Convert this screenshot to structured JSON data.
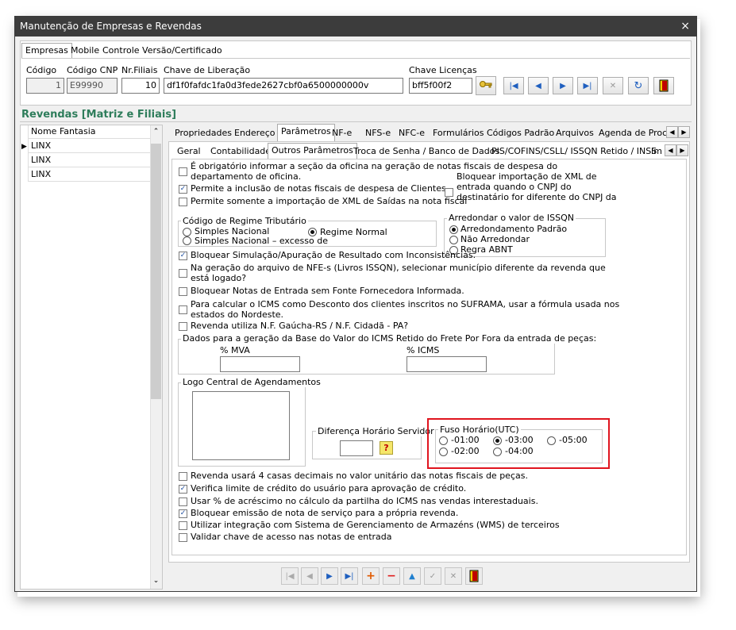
{
  "window": {
    "title": "Manutenção de Empresas e Revendas",
    "close": "×"
  },
  "top_tabs": [
    "Empresas",
    "Mobile",
    "Controle Versão/Certificado"
  ],
  "fields": {
    "codigo_label": "Código",
    "codigo_value": "1",
    "codigo_cnp_label": "Código CNP",
    "codigo_cnp_value": "E99990",
    "nr_filiais_label": "Nr.Filiais",
    "nr_filiais_value": "10",
    "chave_liberacao_label": "Chave de Liberação",
    "chave_liberacao_value": "df1f0fafdc1fa0d3fede2627cbf0a6500000000v",
    "chave_licencas_label": "Chave Licenças",
    "chave_licencas_value": "bff5f00f2"
  },
  "revendas": {
    "title": "Revendas [Matriz e Filiais]",
    "column": "Nome Fantasia",
    "rows": [
      "LINX",
      "LINX",
      "LINX"
    ]
  },
  "main_tabs": [
    "Propriedades",
    "Endereço",
    "Parâmetros",
    "NF-e",
    "NFS-e",
    "NFC-e",
    "Formulários",
    "Códigos Padrão",
    "Arquivos",
    "Agenda de Proces"
  ],
  "sub_tabs": [
    "Geral",
    "Contabilidade",
    "Outros Parâmetros",
    "Troca de Senha / Banco de Dados",
    "PIS/COFINS/CSLL/ ISSQN Retido / INSS",
    "Im"
  ],
  "checks_top": [
    {
      "label": "É obrigatório informar a seção da oficina na geração de notas fiscais de despesa do",
      "label2": "departamento de oficina.",
      "checked": false
    },
    {
      "label": "Permite a inclusão de notas fiscais de despesa de Clientes.",
      "checked": true
    },
    {
      "label": "Permite somente a importação de XML de Saídas na nota fiscal",
      "checked": false
    }
  ],
  "check_xml": {
    "line1": "Bloquear importação de XML de",
    "line2": "entrada quando o CNPJ do",
    "line3": "destinatário for diferente do CNPJ da",
    "checked": false
  },
  "regime": {
    "title": "Código de Regime Tributário",
    "opt1": "Simples Nacional",
    "opt2": "Simples Nacional – excesso de",
    "opt3": "Regime Normal",
    "selected": "Regime Normal"
  },
  "issqn": {
    "title": "Arredondar o valor de ISSQN",
    "opt1": "Arredondamento Padrão",
    "opt2": "Não Arredondar",
    "opt3": "Regra ABNT",
    "selected": "Arredondamento Padrão"
  },
  "checks_mid": [
    {
      "label": "Bloquear Simulação/Apuração de Resultado com Inconsistências.",
      "checked": true
    },
    {
      "label": "Na geração do arquivo de NFE-s (Livros ISSQN), selecionar município diferente da revenda que",
      "label2": "está logado?",
      "checked": false
    },
    {
      "label": "Bloquear  Notas de Entrada sem Fonte Fornecedora Informada.",
      "checked": false
    },
    {
      "label": "Para calcular o ICMS como Desconto dos clientes inscritos no SUFRAMA, usar a fórmula usada nos",
      "label2": "estados do Nordeste.",
      "checked": false
    },
    {
      "label": "Revenda utiliza N.F. Gaúcha-RS / N.F. Cidadã - PA?",
      "checked": false
    }
  ],
  "frete": {
    "title": "Dados para a geração da Base do Valor do ICMS Retido do Frete Por Fora  da entrada de peças:",
    "mva_label": "% MVA",
    "icms_label": "% ICMS",
    "mva_value": "",
    "icms_value": ""
  },
  "logo": {
    "title": "Logo Central de Agendamentos"
  },
  "diferenca": {
    "title": "Diferença Horário Servidor",
    "value": "",
    "help": "?"
  },
  "fuso": {
    "title": "Fuso Horário(UTC)",
    "options": [
      "-01:00",
      "-03:00",
      "-05:00",
      "-02:00",
      "-04:00"
    ],
    "selected": "-03:00",
    "highlight_color": "#e0141e"
  },
  "checks_bottom": [
    {
      "label": "Revenda usará 4 casas decimais no valor unitário das notas fiscais de peças.",
      "checked": false
    },
    {
      "label": "Verifica limite de crédito do usuário para aprovação de crédito.",
      "checked": true
    },
    {
      "label": "Usar % de acréscimo no cálculo da partilha do ICMS nas vendas interestaduais.",
      "checked": false
    },
    {
      "label": "Bloquear emissão de nota de serviço para a própria revenda.",
      "checked": true
    },
    {
      "label": "Utilizar integração com Sistema de Gerenciamento de Armazéns (WMS) de terceiros",
      "checked": false
    },
    {
      "label": "Validar chave de acesso nas notas de entrada",
      "checked": false
    }
  ],
  "top_nav_icons": [
    "key-icon",
    "first-icon",
    "prior-icon",
    "next-icon",
    "last-icon",
    "cancel-icon",
    "refresh-icon",
    "exit-icon"
  ],
  "bottom_nav_icons": [
    "first-icon",
    "prior-icon",
    "next-icon",
    "last-icon",
    "insert-icon",
    "delete-icon",
    "edit-icon",
    "post-icon",
    "cancel-icon",
    "exit-icon"
  ]
}
